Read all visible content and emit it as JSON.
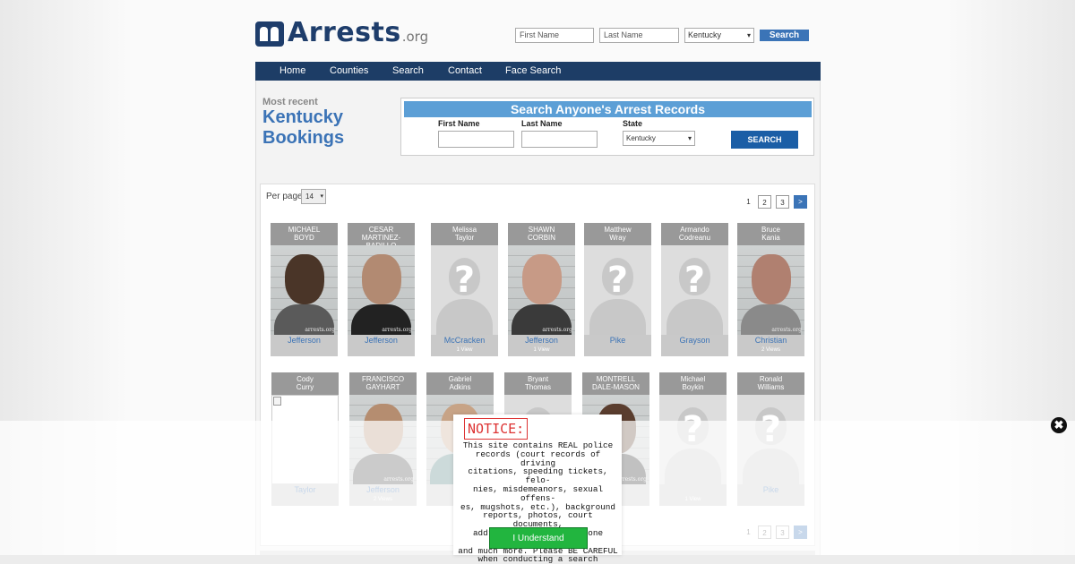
{
  "site": {
    "logo_text": "Arrests",
    "logo_suffix": ".org"
  },
  "header_search": {
    "first_name_placeholder": "First Name",
    "last_name_placeholder": "Last Name",
    "state_value": "Kentucky",
    "button_label": "Search"
  },
  "nav": {
    "items": [
      {
        "label": "Home"
      },
      {
        "label": "Counties"
      },
      {
        "label": "Search"
      },
      {
        "label": "Contact"
      },
      {
        "label": "Face Search"
      }
    ]
  },
  "hero": {
    "kicker": "Most recent",
    "title_line1": "Kentucky",
    "title_line2": "Bookings"
  },
  "search_panel": {
    "heading": "Search Anyone's Arrest Records",
    "first_name_label": "First Name",
    "last_name_label": "Last Name",
    "state_label": "State",
    "state_value": "Kentucky",
    "button_label": "SEARCH"
  },
  "results": {
    "per_page_label": "Per page",
    "per_page_value": "14",
    "pagination": [
      "1",
      "2",
      "3",
      ">"
    ]
  },
  "bookings": [
    {
      "first": "MICHAEL",
      "last": "BOYD",
      "county": "Jefferson",
      "views": "",
      "photo": "mug",
      "skin": "#4a3528",
      "shirt": "#5a5a5a"
    },
    {
      "first": "CESAR",
      "last": "MARTINEZ-BADILLO",
      "county": "Jefferson",
      "views": "",
      "photo": "mug",
      "skin": "#b28a72",
      "shirt": "#222222"
    },
    {
      "first": "Melissa",
      "last": "Taylor",
      "county": "McCracken",
      "views": "1 View",
      "photo": "unknown"
    },
    {
      "first": "SHAWN",
      "last": "CORBIN",
      "county": "Jefferson",
      "views": "1 View",
      "photo": "mug",
      "skin": "#c79a86",
      "shirt": "#3a3a3a"
    },
    {
      "first": "Matthew",
      "last": "Wray",
      "county": "Pike",
      "views": "",
      "photo": "unknown"
    },
    {
      "first": "Armando",
      "last": "Codreanu",
      "county": "Grayson",
      "views": "",
      "photo": "unknown"
    },
    {
      "first": "Bruce",
      "last": "Kania",
      "county": "Christian",
      "views": "2 Views",
      "photo": "mug",
      "skin": "#b08070",
      "shirt": "#8a8a8a"
    },
    {
      "first": "Cody",
      "last": "Curry",
      "county": "Taylor",
      "views": "",
      "photo": "broken"
    },
    {
      "first": "FRANCISCO",
      "last": "GAYHART",
      "county": "Jefferson",
      "views": "2 Views",
      "photo": "mug",
      "skin": "#b58d70",
      "shirt": "#444444"
    },
    {
      "first": "Gabriel",
      "last": "Adkins",
      "county": "",
      "views": "",
      "photo": "mug",
      "skin": "#c7a386",
      "shirt": "#4a7a7a"
    },
    {
      "first": "Bryant",
      "last": "Thomas",
      "county": "",
      "views": "",
      "photo": "unknown"
    },
    {
      "first": "MONTRELL",
      "last": "DALE-MASON",
      "county": "",
      "views": "",
      "photo": "mug",
      "skin": "#5a3d2e",
      "shirt": "#202020"
    },
    {
      "first": "Michael",
      "last": "Boykin",
      "county": "",
      "views": "1 View",
      "photo": "unknown"
    },
    {
      "first": "Ronald",
      "last": "Williams",
      "county": "Pike",
      "views": "",
      "photo": "unknown"
    }
  ],
  "watermark": "arrests.org",
  "notice": {
    "title": "NOTICE:",
    "body": "This site contains REAL police\nrecords (court records of driving\ncitations, speeding tickets, felo-\nnies, misdemeanors, sexual offens-\nes, mugshots, etc.), background\nreports, photos, court documents,\naddress information, phone numbers\nand much more. Please BE CAREFUL\nwhen conducting a search",
    "button_label": "I Understand",
    "close_glyph": "✖"
  },
  "colors": {
    "brand_navy": "#1d3d66",
    "accent_blue": "#3b73b6",
    "notice_red": "#dd3333",
    "understand_green": "#22b53f"
  }
}
